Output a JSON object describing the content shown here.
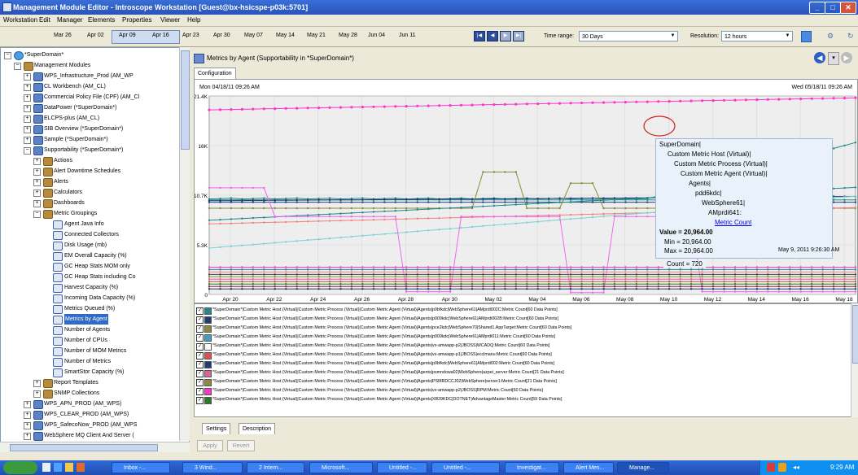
{
  "window": {
    "title": "Management Module Editor - Introscope Workstation [Guest@bx-hsicspe-p03k:5701]"
  },
  "menu": [
    "Workstation",
    "Edit",
    "Manager",
    "Elements",
    "Properties",
    "Viewer",
    "Help"
  ],
  "timebar": {
    "dates": [
      "Mar 26",
      "Apr 02",
      "Apr 09",
      "Apr 16",
      "Apr 23",
      "Apr 30",
      "May 07",
      "May 14",
      "May 21",
      "May 28",
      "Jun 04",
      "Jun 11"
    ],
    "time_range_label": "Time range:",
    "time_range_value": "30 Days",
    "resolution_label": "Resolution:",
    "resolution_value": "12 hours"
  },
  "tree": {
    "root": "*SuperDomain*",
    "modules_label": "Management Modules",
    "modules_top": [
      "WPS_Infrastructure_Prod (AM_WP",
      "CL Workbench (AM_CL)",
      "Commercial Policy File (CPF) (AM_Cl",
      "DataPower (*SuperDomain*)",
      "ELCPS-plus (AM_CL)",
      "SIB Overview (*SuperDomain*)",
      "Sample (*SuperDomain*)",
      "Supportability (*SuperDomain*)"
    ],
    "supportability_children": [
      "Actions",
      "Alert Downtime Schedules",
      "Alerts",
      "Calculators",
      "Dashboards",
      "Metric Groupings"
    ],
    "metric_groupings": [
      "Agent Java Info",
      "Connected Collectors",
      "Disk Usage (mb)",
      "EM Overall Capacity (%)",
      "GC Heap Stats MOM only",
      "GC Heap Stats including Co",
      "Harvest Capacity (%)",
      "Incoming Data Capacity (%)",
      "Metrics Queued (%)",
      "Metrics by Agent",
      "Number of Agents",
      "Number of CPUs",
      "Number of MOM Metrics",
      "Number of Metrics",
      "SmartStor Capacity (%)"
    ],
    "after_groupings": [
      "Report Templates",
      "SNMP Collections"
    ],
    "modules_bottom": [
      "WPS_APN_PROD (AM_WPS)",
      "WPS_CLEAR_PROD (AM_WPS)",
      "WPS_SafecoNow_PROD (AM_WPS",
      "WebSphere MQ Client And Server ("
    ]
  },
  "panel": {
    "title": "Metrics by Agent (Supportability in *SuperDomain*)",
    "tab": "Configuration",
    "bottom_tabs": [
      "Settings",
      "Description"
    ],
    "apply": "Apply",
    "revert": "Revert"
  },
  "chart_data": {
    "type": "line",
    "start_label": "Mon 04/18/11 09:26 AM",
    "end_label": "Wed 05/18/11 09:26 AM",
    "y_ticks": [
      "0",
      "5.3K",
      "10.7K",
      "16K",
      "21.4K"
    ],
    "ylim": [
      0,
      21400
    ],
    "x_ticks": [
      "Apr 20",
      "Apr 22",
      "Apr 24",
      "Apr 26",
      "Apr 28",
      "Apr 30",
      "May 02",
      "May 04",
      "May 06",
      "May 08",
      "May 10",
      "May 12",
      "May 14",
      "May 16",
      "May 18"
    ],
    "n_points": 60,
    "colors": {
      "magenta": "#ff33cc",
      "teal": "#208a8a",
      "navy": "#1f3c7a",
      "olive": "#8a8a3a",
      "salmon": "#f08080",
      "aqua": "#7fd0d0",
      "violet": "#ee66ee"
    },
    "tooltip": {
      "path": [
        "SuperDomain|",
        "Custom Metric Host (Virtual)|",
        "Custom Metric Process (Virtual)|",
        "Custom Metric Agent (Virtual)|",
        "Agents|",
        "pdd6kdc|",
        "WebSphere61|",
        "AMprdi641:"
      ],
      "link": "Metric Count",
      "value": "Value = 20,964.00",
      "min": "Min = 20,964.00",
      "max": "Max = 20,964.00",
      "count": "Count = 720",
      "time": "May 9, 2011 9:26:30 AM"
    }
  },
  "legend_rows": [
    {
      "marker": "teal-star",
      "color": "#208a8a",
      "text": "*SuperDomain*|Custom Metric Host (Virtual)|Custom Metric Process (Virtual)|Custom Metric Agent (Virtual)|Agents|p0bfkdc|WebSphere61|AMprdi002C:Metric Count[60 Data Points]"
    },
    {
      "marker": "navy-diamond",
      "color": "#1f3c7a",
      "text": "*SuperDomain*|Custom Metric Host (Virtual)|Custom Metric Process (Virtual)|Custom Metric Agent (Virtual)|Agents|p009kdc|WebSphere61|AMprdi002B:Metric Count[60 Data Points]"
    },
    {
      "marker": "olive-dot",
      "color": "#8a8a3a",
      "text": "*SuperDomain*|Custom Metric Host (Virtual)|Custom Metric Process (Virtual)|Custom Metric Agent (Virtual)|Agents|pce2kdc|WebSphere70|Shared1.AppTarget:Metric Count[60 Data Points]"
    },
    {
      "marker": "aqua-diamond",
      "color": "#3aa0c8",
      "text": "*SuperDomain*|Custom Metric Host (Virtual)|Custom Metric Process (Virtual)|Custom Metric Agent (Virtual)|Agents|p009kdc|WebSphere61|AMprdi011:Metric Count[60 Data Points]"
    },
    {
      "marker": "white-square",
      "color": "#ffffff",
      "text": "*SuperDomain*|Custom Metric Host (Virtual)|Custom Metric Process (Virtual)|Custom Metric Agent (Virtual)|Agents|vx-amwapp-p2|JBOSS|WCADQ:Metric Count[60 Data Points]"
    },
    {
      "marker": "red-triangle",
      "color": "#e05050",
      "text": "*SuperDomain*|Custom Metric Host (Virtual)|Custom Metric Process (Virtual)|Custom Metric Agent (Virtual)|Agents|vx-amwapp-p1|JBOSS|ecclmanu:Metric Count[60 Data Points]"
    },
    {
      "marker": "navy-triangle",
      "color": "#1f3c7a",
      "text": "*SuperDomain*|Custom Metric Host (Virtual)|Custom Metric Process (Virtual)|Custom Metric Agent (Virtual)|Agents|p0bfkdc|WebSphere61|AMprdi002:Metric Count[60 Data Points]"
    },
    {
      "marker": "pink-square",
      "color": "#e0609a",
      "text": "*SuperDomain*|Custom Metric Host (Virtual)|Custom Metric Process (Virtual)|Custom Metric Agent (Virtual)|Agents|psmndowa02|WebSphere|azpei_server:Metric Count[21 Data Points]"
    },
    {
      "marker": "olive-star",
      "color": "#8a8a3a",
      "text": "*SuperDomain*|Custom Metric Host (Virtual)|Custom Metric Process (Virtual)|Custom Metric Agent (Virtual)|Agents|PSMRDCCJ02|WebSphere|server1:Metric Count[21 Data Points]"
    },
    {
      "marker": "magenta-dot",
      "color": "#ff33cc",
      "text": "*SuperDomain*|Custom Metric Host (Virtual)|Custom Metric Process (Virtual)|Custom Metric Agent (Virtual)|Agents|vx-amwapp-p2|JBOSS|RPM:Metric Count[60 Data Points]"
    },
    {
      "marker": "green-diamond",
      "color": "#2a7a2a",
      "text": "*SuperDomain*|Custom Metric Host (Virtual)|Custom Metric Process (Virtual)|Custom Metric Agent (Virtual)|Agents|XB29KDC|DOTNET|AdvantageMaster:Metric Count[59 Data Points]"
    }
  ],
  "taskbar": {
    "items": [
      "Inbox -...",
      "3 Wind...",
      "2 Intern...",
      "Microsoft...",
      "Untitled -...",
      "Untitled -...",
      "Investigat...",
      "Alert Mes...",
      "Manage..."
    ],
    "clock": "9:29 AM"
  }
}
